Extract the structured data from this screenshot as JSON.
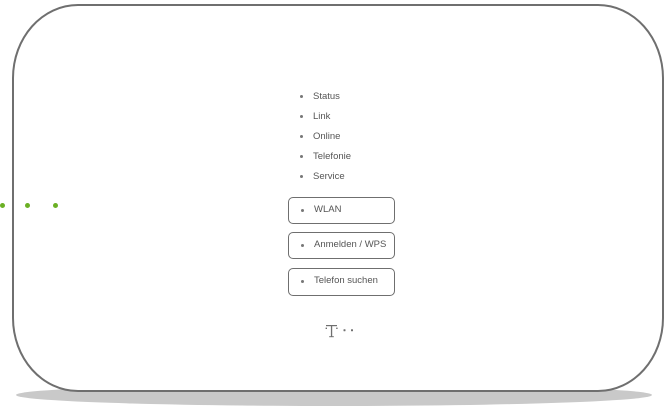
{
  "status_leds": [
    {
      "label": "Status"
    },
    {
      "label": "Link"
    },
    {
      "label": "Online"
    },
    {
      "label": "Telefonie"
    },
    {
      "label": "Service"
    }
  ],
  "buttons": {
    "wlan": "WLAN",
    "anmelden_wps": "Anmelden / WPS",
    "telefon_suchen": "Telefon suchen"
  },
  "colors": {
    "led_green": "#6bb024",
    "outline": "#6f6f6f",
    "text": "#555555"
  },
  "icons": {
    "logo": "telekom-t-logo",
    "side_indicator": "green-led-dots"
  }
}
